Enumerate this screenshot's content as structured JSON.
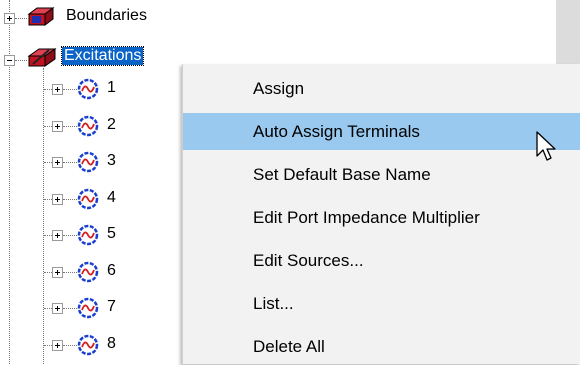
{
  "tree": {
    "boundaries_label": "Boundaries",
    "excitations_label": "Excitations",
    "ports": [
      "1",
      "2",
      "3",
      "4",
      "5",
      "6",
      "7",
      "8"
    ]
  },
  "context_menu": {
    "items": [
      {
        "label": "Assign"
      },
      {
        "label": "Auto Assign Terminals"
      },
      {
        "label": "Set Default Base Name"
      },
      {
        "label": "Edit Port Impedance Multiplier"
      },
      {
        "label": "Edit Sources..."
      },
      {
        "label": "List..."
      },
      {
        "label": "Delete All"
      }
    ],
    "hovered_index": 1
  },
  "colors": {
    "selection": "#0a64c8",
    "menu_hover": "#99c9ef",
    "menu_bg": "#f2f2f2",
    "port_icon": "#1a3fcf",
    "port_wave": "#d42020",
    "boundary_icon": "#c1121f"
  },
  "icons": {
    "boundaries": "boundary-icon",
    "excitations": "excitation-icon",
    "port": "port-icon",
    "cursor": "mouse-pointer-icon"
  }
}
